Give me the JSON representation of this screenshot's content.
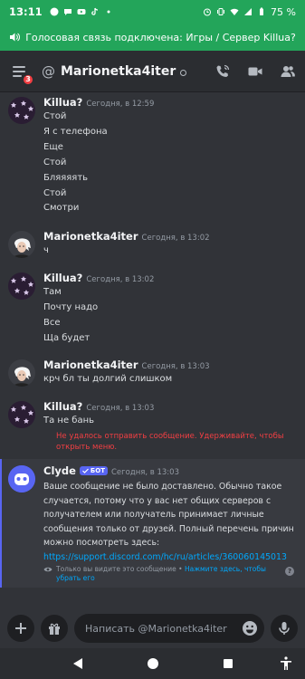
{
  "status_bar": {
    "time": "13:11",
    "battery": "75 %"
  },
  "voice_banner": {
    "text": "Голосовая связь подключена: Игры / Сервер Killua?"
  },
  "header": {
    "at_symbol": "@",
    "title": "Marionetka4iter",
    "unread_badge": "3"
  },
  "messages": [
    {
      "author": "Killua?",
      "timestamp": "Сегодня, в 12:59",
      "lines": [
        "Стой",
        "Я с телефона",
        "Еще",
        "Стой",
        "Бляяяять",
        "Стой",
        "Смотри"
      ]
    },
    {
      "author": "Marionetka4iter",
      "timestamp": "Сегодня, в 13:02",
      "lines": [
        "ч"
      ]
    },
    {
      "author": "Killua?",
      "timestamp": "Сегодня, в 13:02",
      "lines": [
        "Там",
        "Почту надо",
        "Все",
        "Ща будет"
      ]
    },
    {
      "author": "Marionetka4iter",
      "timestamp": "Сегодня, в 13:03",
      "lines": [
        "крч бл ты долгий слишком"
      ]
    },
    {
      "author": "Killua?",
      "timestamp": "Сегодня, в 13:03",
      "lines": [
        "Та не бань"
      ]
    }
  ],
  "send_error": "Не удалось отправить сообщение. Удерживайте, чтобы открыть меню.",
  "clyde": {
    "author": "Clyde",
    "bot_tag": "БОТ",
    "timestamp": "Сегодня, в 13:03",
    "text": "Ваше сообщение не было доставлено. Обычно такое случается, потому что у вас нет общих серверов с получателем или получатель принимает личные сообщения только от друзей. Полный перечень причин можно посмотреть здесь:",
    "link": "https://support.discord.com/hc/ru/articles/360060145013",
    "ephemeral_note": "Только вы видите это сообщение •",
    "ephemeral_action": "Нажмите здесь, чтобы убрать его"
  },
  "composer": {
    "placeholder": "Написать @Marionetka4iter"
  },
  "colors": {
    "accent": "#5865f2",
    "voice_green": "#23a55a",
    "error": "#f23f43",
    "link": "#00a8fc"
  }
}
